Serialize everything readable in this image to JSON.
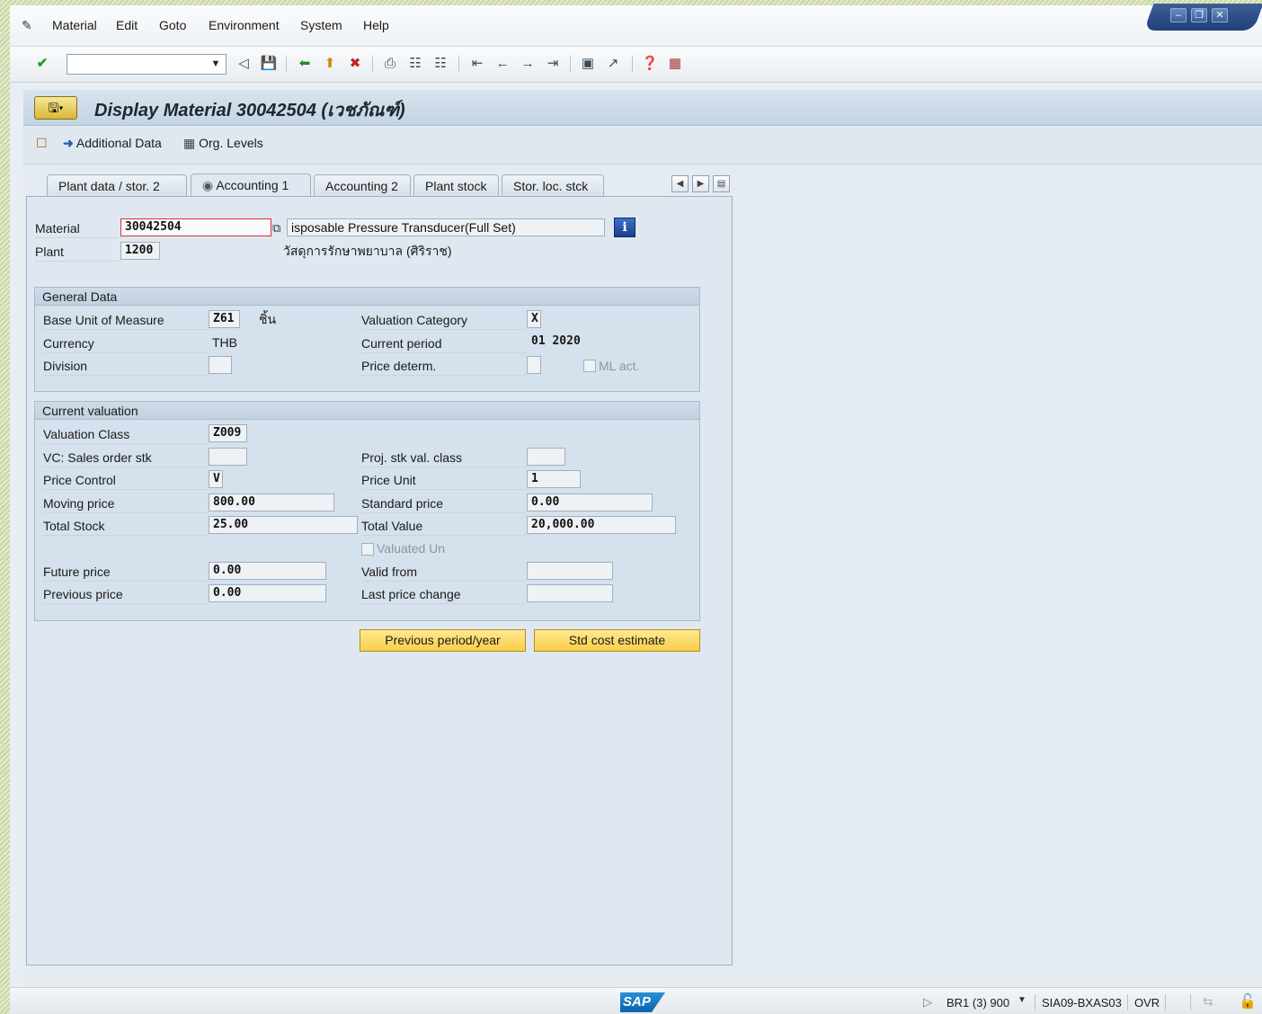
{
  "menubar": {
    "items": [
      {
        "label": "Material"
      },
      {
        "label": "Edit"
      },
      {
        "label": "Goto"
      },
      {
        "label": "Environment"
      },
      {
        "label": "System"
      },
      {
        "label": "Help"
      }
    ]
  },
  "toolbar": {
    "command_field_value": "",
    "icons": [
      "enter-icon",
      "back-icon",
      "save-icon",
      "back-nav-icon",
      "exit-icon",
      "cancel-icon",
      "print-icon",
      "find-icon",
      "find-next-icon",
      "first-page-icon",
      "previous-page-icon",
      "next-page-icon",
      "last-page-icon",
      "create-session-icon",
      "shortcut-icon",
      "help-icon",
      "layout-icon"
    ]
  },
  "title": {
    "text": "Display Material 30042504 (เวชภัณฑ์)"
  },
  "app_toolbar": {
    "additional_data": "Additional Data",
    "org_levels": "Org. Levels"
  },
  "tabs": [
    {
      "label": "Plant data / stor. 2",
      "active": false
    },
    {
      "label": "Accounting 1",
      "active": true
    },
    {
      "label": "Accounting 2",
      "active": false
    },
    {
      "label": "Plant stock",
      "active": false
    },
    {
      "label": "Stor. loc. stck",
      "active": false
    }
  ],
  "header_fields": {
    "material_label": "Material",
    "material_value": "30042504",
    "material_desc": "isposable Pressure Transducer(Full Set)",
    "plant_label": "Plant",
    "plant_value": "1200",
    "plant_desc": "วัสดุการรักษาพยาบาล (ศิริราช)"
  },
  "general_data": {
    "title": "General Data",
    "base_uom_label": "Base Unit of Measure",
    "base_uom_value": "Z61",
    "base_uom_text": "ชิ้น",
    "valuation_category_label": "Valuation Category",
    "valuation_category_value": "X",
    "currency_label": "Currency",
    "currency_value": "THB",
    "current_period_label": "Current period",
    "current_period_value": "01 2020",
    "division_label": "Division",
    "division_value": "",
    "price_determ_label": "Price determ.",
    "price_determ_value": "",
    "ml_act_label": "ML act.",
    "ml_act_checked": false
  },
  "current_valuation": {
    "title": "Current valuation",
    "valuation_class_label": "Valuation Class",
    "valuation_class_value": "Z009",
    "vc_sales_label": "VC: Sales order stk",
    "vc_sales_value": "",
    "proj_stk_label": "Proj. stk val. class",
    "proj_stk_value": "",
    "price_control_label": "Price Control",
    "price_control_value": "V",
    "price_unit_label": "Price Unit",
    "price_unit_value": "1",
    "moving_price_label": "Moving price",
    "moving_price_value": "800.00",
    "standard_price_label": "Standard price",
    "standard_price_value": "0.00",
    "total_stock_label": "Total Stock",
    "total_stock_value": "25.00",
    "total_value_label": "Total Value",
    "total_value_value": "20,000.00",
    "valuated_un_label": "Valuated Un",
    "valuated_un_checked": false,
    "future_price_label": "Future price",
    "future_price_value": "0.00",
    "valid_from_label": "Valid from",
    "valid_from_value": "",
    "previous_price_label": "Previous price",
    "previous_price_value": "0.00",
    "last_price_change_label": "Last price change",
    "last_price_change_value": ""
  },
  "buttons": {
    "previous_period": "Previous period/year",
    "std_cost_estimate": "Std cost estimate"
  },
  "statusbar": {
    "logo": "SAP",
    "system": "BR1 (3) 900",
    "server": "SIA09-BXAS03",
    "mode": "OVR"
  }
}
